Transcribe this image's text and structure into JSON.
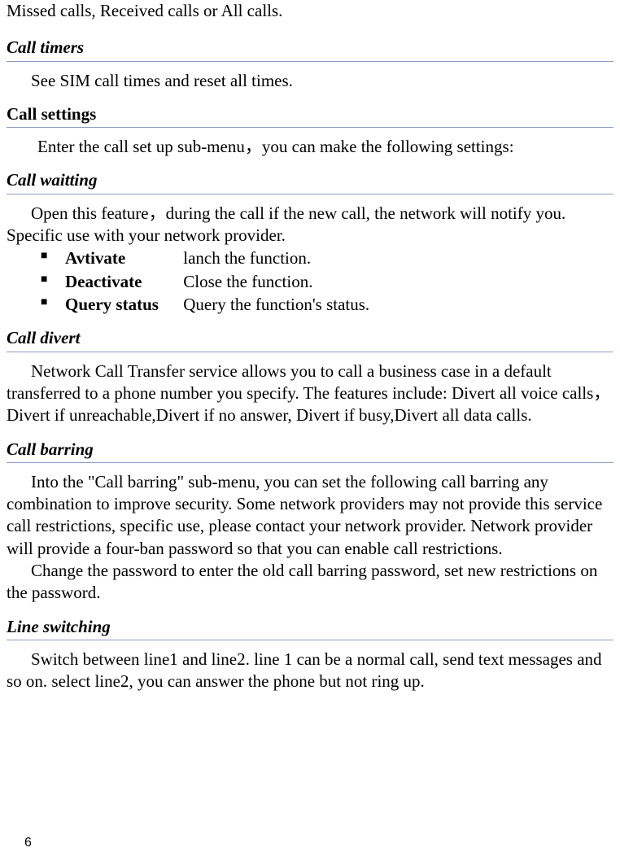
{
  "intro": "Missed calls, Received calls or All calls.",
  "sections": {
    "callTimers": {
      "heading": "Call timers",
      "text": "See SIM call times and reset all times."
    },
    "callSettings": {
      "heading": "Call settings",
      "text": "Enter the call set up sub-menu，you can make the following settings:"
    },
    "callWaiting": {
      "heading": "Call waitting",
      "intro": "Open this feature，during the call if the new call, the network will notify you. Specific use with your network provider.",
      "items": [
        {
          "term": "Avtivate",
          "desc": "lanch the function."
        },
        {
          "term": "Deactivate",
          "desc": "Close the function."
        },
        {
          "term": "Query status",
          "desc": "Query the function's status."
        }
      ]
    },
    "callDivert": {
      "heading": "Call divert",
      "text": "Network Call Transfer service allows you to call a business case in a default transferred to a phone number you specify. The features include: Divert all voice calls，Divert if unreachable,Divert if no answer, Divert if busy,Divert all data calls."
    },
    "callBarring": {
      "heading": "Call barring",
      "para1": "Into the \"Call barring\" sub-menu, you can set the following call barring any combination to improve security. Some network providers may not provide this service call restrictions, specific use, please contact your network provider. Network provider will provide a four-ban password so that you can enable call restrictions.",
      "para2": "Change the password to enter the old call barring password, set new restrictions on the password."
    },
    "lineSwitching": {
      "heading": "Line switching",
      "text": "Switch between line1 and line2. line 1 can be a normal call, send text messages and so on. select line2, you can answer the phone but not ring up."
    }
  },
  "pageNumber": "6"
}
